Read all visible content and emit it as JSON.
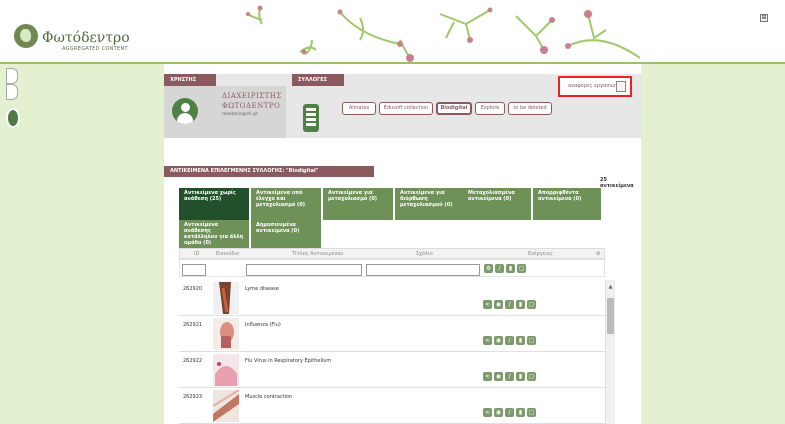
{
  "logo": {
    "title": "Φωτόδεντρο",
    "subtitle": "AGGREGATED CONTENT"
  },
  "header": {
    "corner_button": "⊞"
  },
  "user_panel": {
    "section_label": "ΧΡΗΣΤΗΣ",
    "name_line1": "ΔΙΑΧΕΙΡΙΣΤΗΣ",
    "name_line2": "ΦΩΤΟΔΕΝΤΡΟ",
    "email": "mastoris@cti.gr"
  },
  "collections": {
    "section_label": "ΣΥΛΛΟΓΕΣ",
    "buttons": [
      "Aimatos",
      "Edusoft collection",
      "Biodigital",
      "Explore",
      "to be deleted"
    ],
    "selected": "Biodigital"
  },
  "report_button": {
    "label": "αναφορές εργασιών"
  },
  "collection_title": "ΑΝΤΙΚΕΙΜΕΝΑ ΕΠΙΛΕΓΜΕΝΗΣ ΣΥΛΛΟΓΗΣ: \"Biodigital\"",
  "count": "25 αντικείμενα",
  "status_tabs": [
    {
      "label": "Αντικείμενα χωρίς ανάθεση (25)"
    },
    {
      "label": "Αντικείμενα υπό έλεγχο και μεταχολιασμό (0)"
    },
    {
      "label": "Αντικείμενα για μεταχολιασμό (0)"
    },
    {
      "label": "Αντικείμενα για διόρθωση μεταχολιασμού (0)"
    },
    {
      "label": "Μεταχολιασμένα αντικείμενα (0)"
    },
    {
      "label": "Απορριφθέντα αντικείμενα (0)"
    },
    {
      "label": "Αντικείμενα ανάθεσης κατάλληλου για άλλη ομάδα (0)"
    },
    {
      "label": "Δημοσιευμένα αντικείμενα (0)"
    }
  ],
  "grid": {
    "columns": [
      "ID",
      "Εικονίδιο",
      "Τίτλος Αντικειμένου",
      "Σχόλιο",
      "Ενέργειες"
    ],
    "rows": [
      {
        "id": "262920",
        "title": "Lyme disease"
      },
      {
        "id": "262921",
        "title": "Influenza (Flu)"
      },
      {
        "id": "262922",
        "title": "Flu Virus in Respiratory Epithelium"
      },
      {
        "id": "262923",
        "title": "Muscle contraction"
      }
    ]
  },
  "colors": {
    "brand_green": "#4f8146",
    "accent_burgundy": "#8a5a5e",
    "active_tab": "#21502a",
    "tab_green": "#6e9157",
    "background_green": "#e3f1d0",
    "highlight_red": "#e22222"
  },
  "icons": [
    "logo-leaf-icon",
    "user-avatar-icon",
    "collection-icon",
    "report-icon",
    "scroll-up-icon"
  ]
}
